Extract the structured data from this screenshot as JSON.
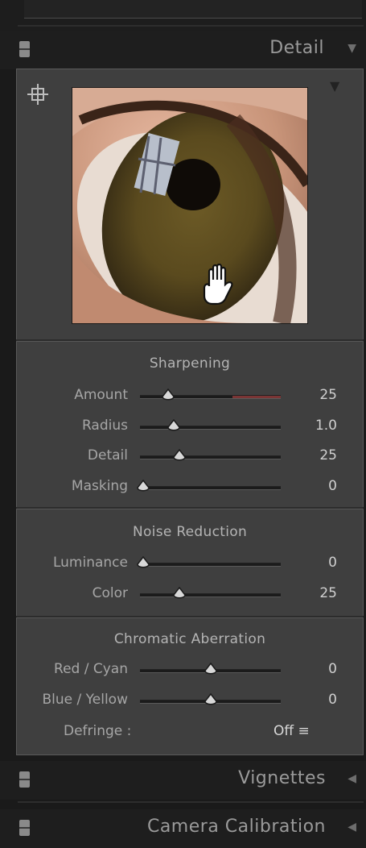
{
  "detail_header": {
    "title": "Detail"
  },
  "vignettes_header": {
    "title": "Vignettes"
  },
  "camera_header": {
    "title": "Camera Calibration"
  },
  "sharpening": {
    "title": "Sharpening",
    "sliders": [
      {
        "label": "Amount",
        "value": "25",
        "level": 0.2
      },
      {
        "label": "Radius",
        "value": "1.0",
        "level": 0.24
      },
      {
        "label": "Detail",
        "value": "25",
        "level": 0.28
      },
      {
        "label": "Masking",
        "value": "0",
        "level": 0.02
      }
    ]
  },
  "noise": {
    "title": "Noise Reduction",
    "sliders": [
      {
        "label": "Luminance",
        "value": "0",
        "level": 0.02
      },
      {
        "label": "Color",
        "value": "25",
        "level": 0.28
      }
    ]
  },
  "chromatic": {
    "title": "Chromatic Aberration",
    "sliders": [
      {
        "label": "Red / Cyan",
        "value": "0",
        "level": 0.5
      },
      {
        "label": "Blue / Yellow",
        "value": "0",
        "level": 0.5
      }
    ],
    "defringe_label": "Defringe :",
    "defringe_value": "Off ≡"
  },
  "icons": {
    "crosshair": "target-crosshair-icon",
    "panel_menu": "triangle-down-icon",
    "hand": "hand-cursor-icon"
  }
}
